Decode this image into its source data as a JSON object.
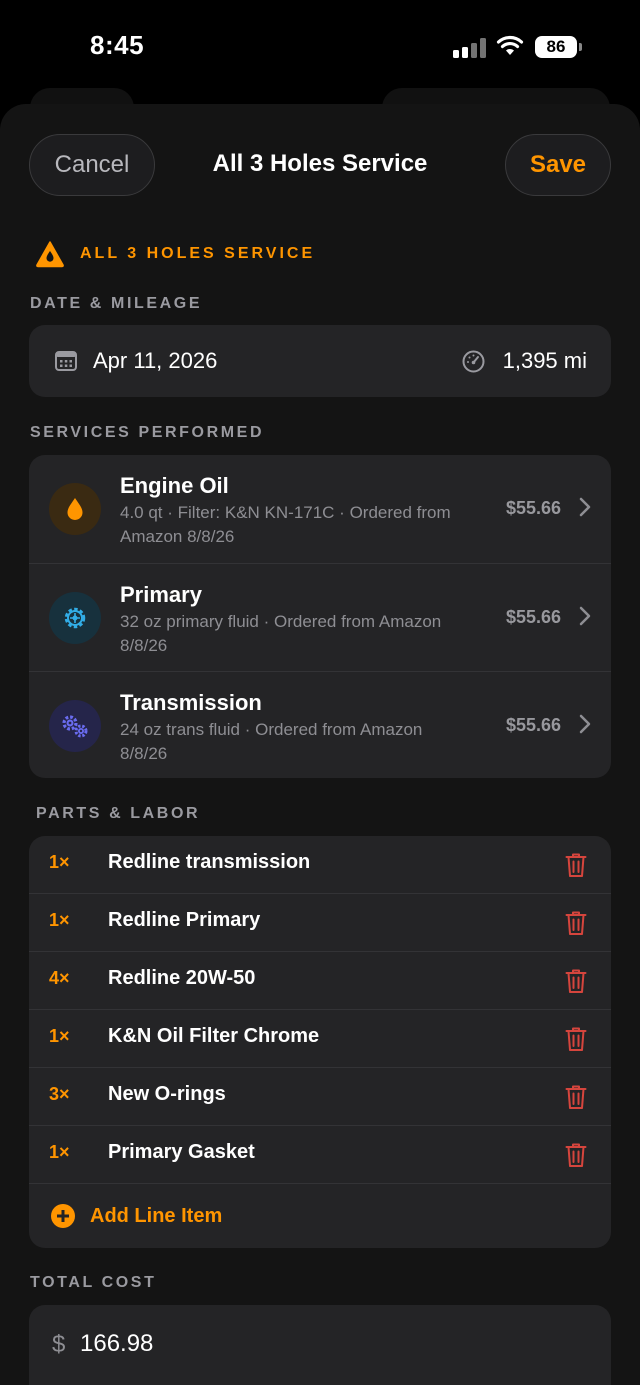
{
  "status": {
    "time": "8:45",
    "battery": "86"
  },
  "nav": {
    "cancel_label": "Cancel",
    "title": "All 3 Holes Service",
    "save_label": "Save"
  },
  "banner": {
    "text": "ALL 3 HOLES SERVICE",
    "icon": "oil-drop-warning-icon"
  },
  "sections": {
    "date_mileage": "DATE & MILEAGE",
    "services": "SERVICES PERFORMED",
    "parts": "PARTS & LABOR",
    "total": "TOTAL COST"
  },
  "date": {
    "value": "Apr 11, 2026",
    "icon": "calendar-icon"
  },
  "mileage": {
    "value": "1,395 mi",
    "icon": "odometer-icon"
  },
  "services": [
    {
      "name": "Engine Oil",
      "detail": "4.0 qt · Filter: K&N KN-171C · Ordered from Amazon 8/8/26",
      "price": "$55.66",
      "icon": "oil-drop-icon",
      "color": "#ff9500"
    },
    {
      "name": "Primary",
      "detail": "32 oz primary fluid · Ordered from Amazon 8/8/26",
      "price": "$55.66",
      "icon": "gear-icon",
      "color": "#32ade6"
    },
    {
      "name": "Transmission",
      "detail": "24 oz trans fluid · Ordered from Amazon 8/8/26",
      "price": "$55.66",
      "icon": "gears-icon",
      "color": "#5e5ce6"
    }
  ],
  "parts": [
    {
      "qty": "1×",
      "name": "Redline transmission"
    },
    {
      "qty": "1×",
      "name": "Redline Primary"
    },
    {
      "qty": "4×",
      "name": "Redline 20W-50"
    },
    {
      "qty": "1×",
      "name": "K&N Oil Filter Chrome"
    },
    {
      "qty": "3×",
      "name": "New O-rings"
    },
    {
      "qty": "1×",
      "name": "Primary Gasket"
    }
  ],
  "add_line_item": "Add Line Item",
  "total": {
    "currency": "$",
    "value": "166.98"
  },
  "colors": {
    "accent": "#ff9500",
    "delete": "#d6453d",
    "card": "#242426",
    "background": "#141414"
  }
}
